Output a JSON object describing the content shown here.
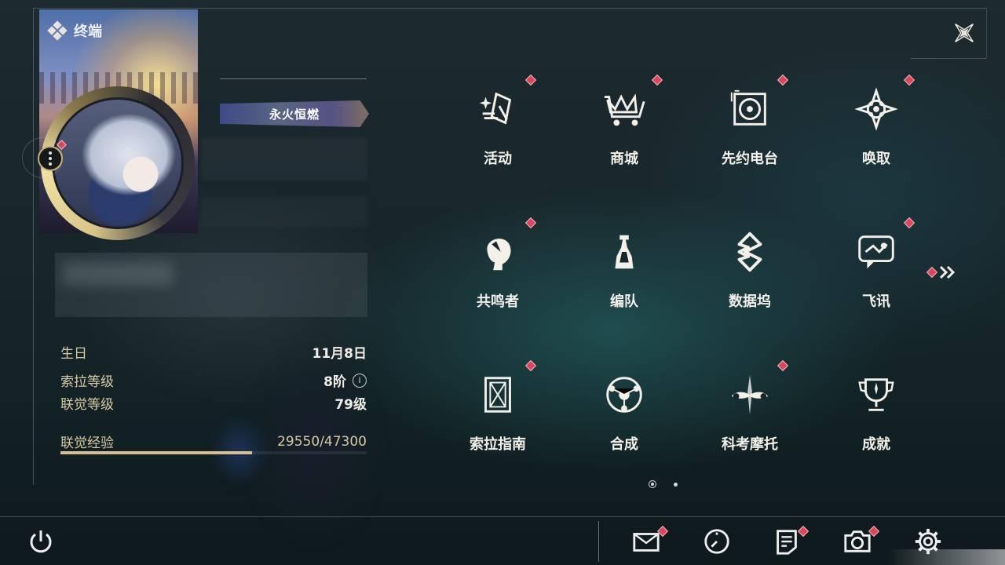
{
  "header": {
    "title": "终端"
  },
  "profile": {
    "title_badge": "永火恒燃",
    "stats": [
      {
        "label": "生日",
        "value": "11月8日"
      },
      {
        "label": "索拉等级",
        "value": "8阶"
      },
      {
        "label": "联觉等级",
        "value": "79级"
      }
    ],
    "exp": {
      "label": "联觉经验",
      "value": "29550/47300",
      "fraction": 0.625
    }
  },
  "menu": {
    "items": [
      {
        "label": "活动",
        "icon": "activity-icon",
        "badge": true
      },
      {
        "label": "商城",
        "icon": "shop-crown-cart-icon",
        "badge": true
      },
      {
        "label": "先约电台",
        "icon": "radio-record-icon",
        "badge": true
      },
      {
        "label": "唤取",
        "icon": "compass-star-icon",
        "badge": true
      },
      {
        "label": "共鸣者",
        "icon": "resonator-head-icon",
        "badge": true
      },
      {
        "label": "编队",
        "icon": "chess-formation-icon",
        "badge": false
      },
      {
        "label": "数据坞",
        "icon": "data-dock-icon",
        "badge": false
      },
      {
        "label": "飞讯",
        "icon": "chat-message-icon",
        "badge": true
      },
      {
        "label": "索拉指南",
        "icon": "guide-book-icon",
        "badge": true
      },
      {
        "label": "合成",
        "icon": "synthesis-orbit-icon",
        "badge": false
      },
      {
        "label": "科考摩托",
        "icon": "motorcycle-icon",
        "badge": true
      },
      {
        "label": "成就",
        "icon": "trophy-icon",
        "badge": false
      }
    ],
    "page": {
      "current": 1,
      "total": 2
    }
  },
  "bottom_bar": {
    "icons": [
      "mail-icon",
      "clock-icon",
      "notes-icon",
      "camera-icon",
      "settings-gear-icon"
    ],
    "power": "power-icon"
  },
  "colors": {
    "badge": "#d9485a",
    "accent_gold": "#d6bf94",
    "text": "#f3f0ea"
  }
}
